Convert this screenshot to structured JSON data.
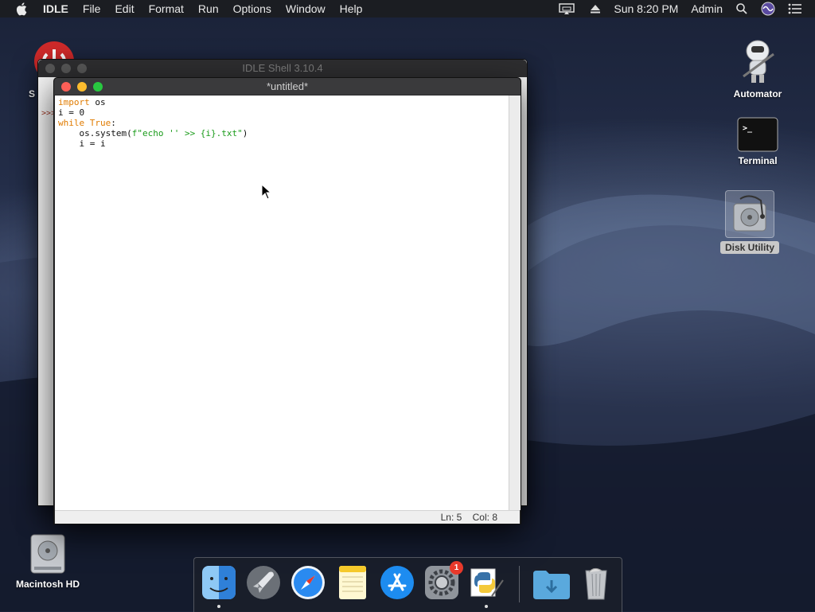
{
  "menubar": {
    "app_name": "IDLE",
    "items": [
      "File",
      "Edit",
      "Format",
      "Run",
      "Options",
      "Window",
      "Help"
    ],
    "clock": "Sun 8:20 PM",
    "user": "Admin"
  },
  "desktop": {
    "icons": {
      "automator": "Automator",
      "terminal": "Terminal",
      "disk_utility": "Disk Utility",
      "macintosh_hd": "Macintosh HD",
      "partial_left": "S"
    }
  },
  "shell_window": {
    "title": "IDLE Shell 3.10.4",
    "prompt": ">>>"
  },
  "editor_window": {
    "title": "*untitled*",
    "code": {
      "l1_kw": "import",
      "l1_rest": " os",
      "l2": "i = 0",
      "l3_kw": "while",
      "l3_sp": " ",
      "l3_kw2": "True",
      "l3_rest": ":",
      "l4_pre": "    os.system(",
      "l4_str": "f\"echo '' >> {i}.txt\"",
      "l4_post": ")",
      "l5": "    i = i"
    },
    "status": {
      "line": "Ln: 5",
      "col": "Col: 8"
    }
  },
  "dock": {
    "items": [
      "finder",
      "launchpad",
      "safari",
      "notes",
      "app-store",
      "system-preferences",
      "python-idle",
      "downloads",
      "trash"
    ],
    "system_preferences_badge": "1"
  },
  "colors": {
    "keyword": "#e07b00",
    "string": "#1a9b1a",
    "close": "#fc5f57",
    "minimize": "#fdbc2e",
    "zoom": "#28c840"
  }
}
